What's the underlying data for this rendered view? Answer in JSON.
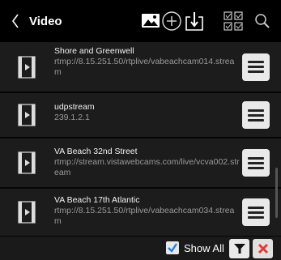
{
  "header": {
    "title": "Video",
    "icons": [
      "back-icon",
      "image-icon",
      "add-circle-icon",
      "download-icon",
      "checklist-grid-icon",
      "search-icon"
    ]
  },
  "items": [
    {
      "name": "Shore and Greenwell",
      "url": "rtmp://8.15.251.50/rtplive/vabeachcam014.stream"
    },
    {
      "name": "udpstream",
      "url": "239.1.2.1"
    },
    {
      "name": "VA  Beach 32nd Street",
      "url": "rtmp://stream.vistawebcams.com/live/vcva002.stream"
    },
    {
      "name": "VA Beach 17th Atlantic",
      "url": "rtmp://8.15.251.50/rtplive/vabeachcam034.stream"
    }
  ],
  "footer": {
    "show_all_label": "Show All",
    "show_all_checked": true,
    "icons": [
      "filter-icon",
      "close-icon"
    ]
  },
  "colors": {
    "background": "#000000",
    "row_background": "#1c1c1c",
    "button_light": "#e9e9e9",
    "checkbox_check": "#2a7fe0",
    "close_red": "#e53935"
  }
}
